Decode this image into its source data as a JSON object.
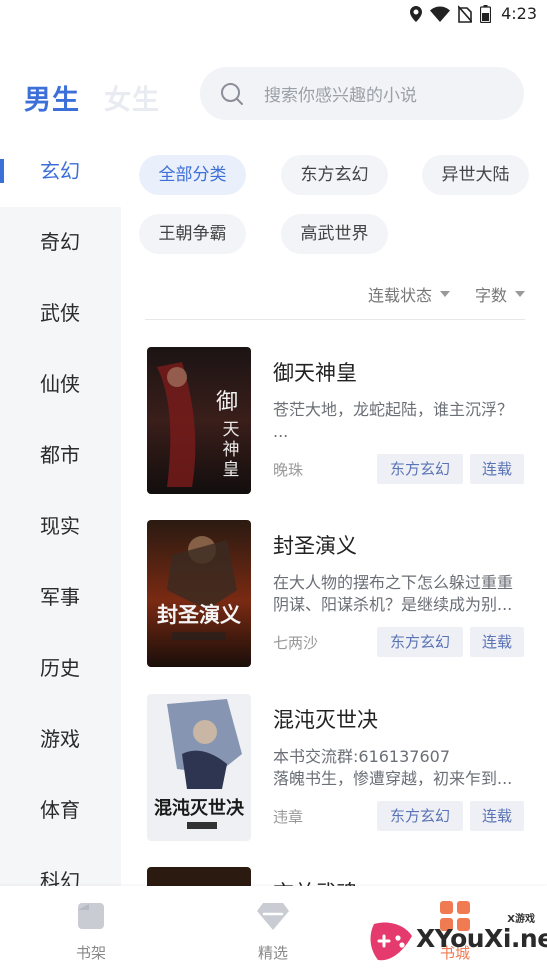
{
  "status_bar": {
    "time": "4:23",
    "icons": [
      "location-icon",
      "wifi-icon",
      "no-sim-icon",
      "battery-icon"
    ]
  },
  "header": {
    "tabs": [
      {
        "label": "男生",
        "active": true
      },
      {
        "label": "女生",
        "active": false
      }
    ],
    "search": {
      "placeholder": "搜索你感兴趣的小说",
      "icon": "search-icon"
    }
  },
  "sidebar": {
    "items": [
      {
        "label": "玄幻",
        "active": true
      },
      {
        "label": "奇幻"
      },
      {
        "label": "武侠"
      },
      {
        "label": "仙侠"
      },
      {
        "label": "都市"
      },
      {
        "label": "现实"
      },
      {
        "label": "军事"
      },
      {
        "label": "历史"
      },
      {
        "label": "游戏"
      },
      {
        "label": "体育"
      },
      {
        "label": "科幻"
      }
    ]
  },
  "subcategories": [
    {
      "label": "全部分类",
      "active": true
    },
    {
      "label": "东方玄幻"
    },
    {
      "label": "异世大陆"
    },
    {
      "label": "王朝争霸"
    },
    {
      "label": "高武世界"
    }
  ],
  "filters": {
    "status": "连载状态",
    "words": "字数"
  },
  "books": [
    {
      "title": "御天神皇",
      "desc": "苍茫大地，龙蛇起陆，谁主沉浮？ ...",
      "author": "晚珠",
      "genre": "东方玄幻",
      "status": "连载",
      "cover_text": "御天神皇"
    },
    {
      "title": "封圣演义",
      "desc": "在大人物的摆布之下怎么躲过重重阴谋、阳谋杀机？是继续成为别...",
      "author": "七两沙",
      "genre": "东方玄幻",
      "status": "连载",
      "cover_text": "封圣演义"
    },
    {
      "title": "混沌灭世决",
      "desc": "本书交流群:616137607\n落魄书生，惨遭穿越，初来乍到...",
      "author": "违章",
      "genre": "东方玄幻",
      "status": "连载",
      "cover_text": "混沌灭世决"
    },
    {
      "title": "玄羊武魂",
      "cover_text": ""
    }
  ],
  "bottom_nav": [
    {
      "label": "书架",
      "icon": "bookshelf-icon"
    },
    {
      "label": "精选",
      "icon": "diamond-icon"
    },
    {
      "label": "书城",
      "icon": "grid-icon"
    }
  ],
  "watermark": {
    "small": "X游戏",
    "main": "XYouXi.net"
  },
  "colors": {
    "accent": "#3c6fd8",
    "sidebar_bg": "#f5f6f8",
    "tag_bg": "#eef0f6",
    "chip_bg": "#f3f4f7"
  }
}
